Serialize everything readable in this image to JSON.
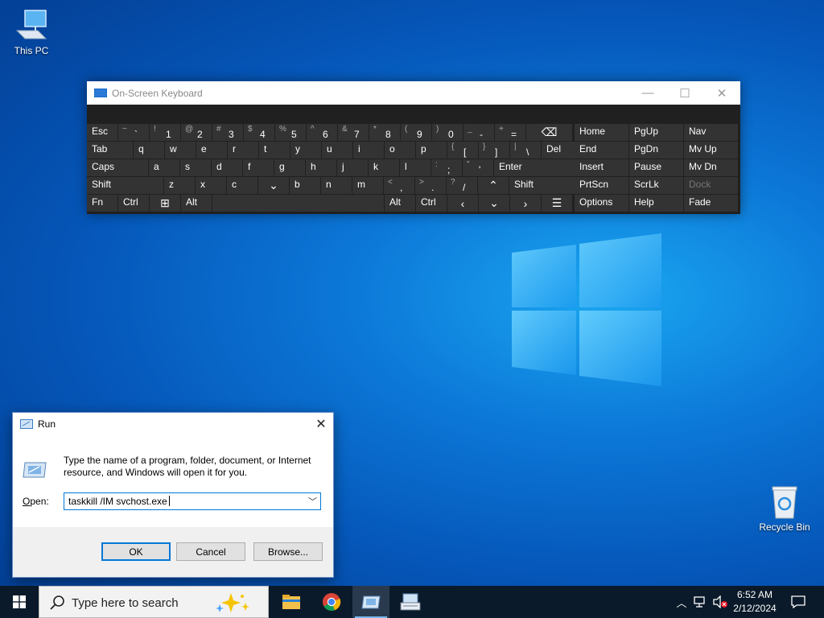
{
  "desktop": {
    "this_pc_label": "This PC",
    "recycle_bin_label": "Recycle Bin"
  },
  "osk": {
    "title": "On-Screen Keyboard",
    "rows": [
      [
        {
          "main": "Esc"
        },
        {
          "shift": "~",
          "main": "`"
        },
        {
          "shift": "!",
          "main": "1"
        },
        {
          "shift": "@",
          "main": "2"
        },
        {
          "shift": "#",
          "main": "3"
        },
        {
          "shift": "$",
          "main": "4"
        },
        {
          "shift": "%",
          "main": "5"
        },
        {
          "shift": "^",
          "main": "6"
        },
        {
          "shift": "&",
          "main": "7"
        },
        {
          "shift": "*",
          "main": "8"
        },
        {
          "shift": "(",
          "main": "9"
        },
        {
          "shift": ")",
          "main": "0"
        },
        {
          "shift": "_",
          "main": "-"
        },
        {
          "shift": "+",
          "main": "="
        },
        {
          "main": "⌫"
        },
        {
          "main": "Home"
        },
        {
          "main": "PgUp"
        },
        {
          "main": "Nav"
        }
      ],
      [
        {
          "main": "Tab"
        },
        {
          "main": "q"
        },
        {
          "main": "w"
        },
        {
          "main": "e"
        },
        {
          "main": "r"
        },
        {
          "main": "t"
        },
        {
          "main": "y"
        },
        {
          "main": "u"
        },
        {
          "main": "i"
        },
        {
          "main": "o"
        },
        {
          "main": "p"
        },
        {
          "shift": "{",
          "main": "["
        },
        {
          "shift": "}",
          "main": "]"
        },
        {
          "shift": "|",
          "main": "\\"
        },
        {
          "main": "Del"
        },
        {
          "main": "End"
        },
        {
          "main": "PgDn"
        },
        {
          "main": "Mv Up"
        }
      ],
      [
        {
          "main": "Caps"
        },
        {
          "main": "a"
        },
        {
          "main": "s"
        },
        {
          "main": "d"
        },
        {
          "main": "f"
        },
        {
          "main": "g"
        },
        {
          "main": "h"
        },
        {
          "main": "j"
        },
        {
          "main": "k"
        },
        {
          "main": "l"
        },
        {
          "shift": ":",
          "main": ";"
        },
        {
          "shift": "\"",
          "main": "'"
        },
        {
          "main": "Enter"
        },
        {
          "main": "Insert"
        },
        {
          "main": "Pause"
        },
        {
          "main": "Mv Dn"
        }
      ],
      [
        {
          "main": "Shift"
        },
        {
          "main": "z"
        },
        {
          "main": "x"
        },
        {
          "main": "c"
        },
        {
          "main": "v"
        },
        {
          "main": "b"
        },
        {
          "main": "n"
        },
        {
          "main": "m"
        },
        {
          "shift": "<",
          "main": ","
        },
        {
          "shift": ">",
          "main": "."
        },
        {
          "shift": "?",
          "main": "/"
        },
        {
          "main": "^"
        },
        {
          "main": "Shift"
        },
        {
          "main": "PrtScn"
        },
        {
          "main": "ScrLk"
        },
        {
          "main": "Dock"
        }
      ],
      [
        {
          "main": "Fn"
        },
        {
          "main": "Ctrl"
        },
        {
          "main": "⊞"
        },
        {
          "main": "Alt"
        },
        {
          "main": ""
        },
        {
          "main": "Alt"
        },
        {
          "main": "Ctrl"
        },
        {
          "main": "<"
        },
        {
          "main": "v"
        },
        {
          "main": ">"
        },
        {
          "main": "☰"
        },
        {
          "main": "Options"
        },
        {
          "main": "Help"
        },
        {
          "main": "Fade"
        }
      ]
    ]
  },
  "run": {
    "title": "Run",
    "description": "Type the name of a program, folder, document, or Internet resource, and Windows will open it for you.",
    "open_label": "Open:",
    "open_value": "taskkill /IM svchost.exe",
    "ok_label": "OK",
    "cancel_label": "Cancel",
    "browse_label": "Browse..."
  },
  "taskbar": {
    "search_placeholder": "Type here to search",
    "time": "6:52 AM",
    "date": "2/12/2024"
  }
}
